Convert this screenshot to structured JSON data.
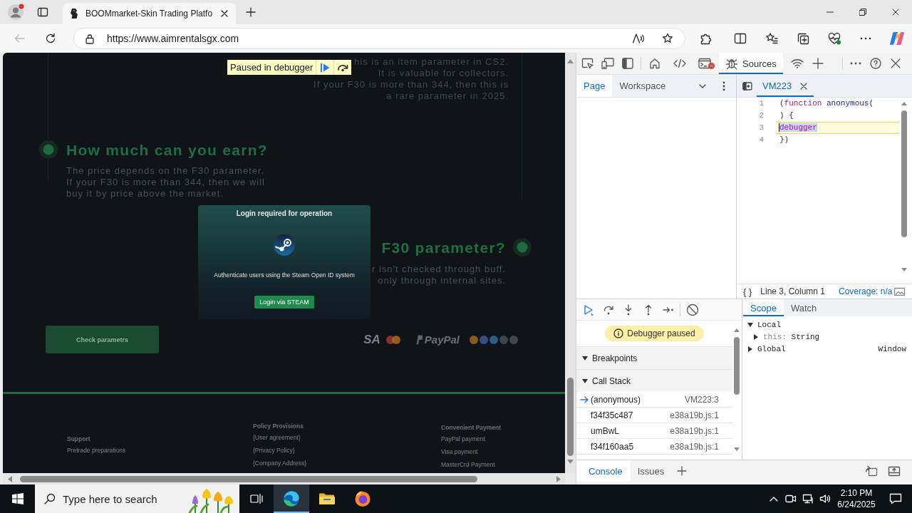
{
  "browser": {
    "tab": {
      "title": "BOOMmarket-Skin Trading Platfo",
      "selected": true
    },
    "back": {
      "disabled": true
    },
    "url": "https://www.aimrentalsgx.com"
  },
  "page": {
    "debugger_banner": "Paused in debugger",
    "intro": [
      {
        "lines": [
          "his is an item parameter in CS2."
        ]
      },
      {
        "lines": [
          "It is valuable for collectors."
        ]
      },
      {
        "lines": [
          "If your F30 is more than 344, then this is",
          "a rare parameter in 2025."
        ]
      }
    ],
    "sections": [
      {
        "heading": "How much can you earn?",
        "lines": [
          "The price depends on the F30 parameter.",
          "If your F30 is more than 344, then we will",
          "buy it by price above the market."
        ]
      },
      {
        "heading": "F30 parameter?",
        "lines": [
          "r isn't checked through buff.",
          "only through internal sites."
        ]
      }
    ],
    "check_button": "Check parametrs",
    "payment_logos": [
      {
        "kind": "visa",
        "text": "SA"
      },
      {
        "kind": "mastercard"
      },
      {
        "kind": "paypal",
        "text": "PayPal"
      },
      {
        "kind": "coins"
      }
    ],
    "modal": {
      "title": "Login required for operation",
      "text": "Authenticate users using the Steam Open ID system",
      "button": "Login via STEAM"
    },
    "footer": [
      {
        "title": "Support",
        "links": [
          "Pretrade preparations"
        ]
      },
      {
        "title": "Policy Provisions",
        "links": [
          "{User agreement}",
          "{Privacy Policy}",
          "{Company Address}"
        ]
      },
      {
        "title": "Convenient Payment",
        "links": [
          "PayPal payment",
          "Visa payment",
          "MasterCrd Payment"
        ]
      }
    ]
  },
  "devtools": {
    "panel_tabs": [
      {
        "kind": "home",
        "selected": false,
        "badge": false
      },
      {
        "kind": "elements",
        "selected": false,
        "badge": false
      },
      {
        "kind": "console",
        "selected": false,
        "badge": true
      },
      {
        "kind": "sources",
        "label": "Sources",
        "selected": true,
        "badge": false
      },
      {
        "kind": "network",
        "selected": false,
        "badge": false
      }
    ],
    "navigator_tabs": [
      {
        "label": "Page",
        "selected": true
      },
      {
        "label": "Workspace",
        "selected": false
      }
    ],
    "editor_tabs": [
      {
        "label": "VM223",
        "selected": true
      }
    ],
    "code": [
      {
        "number": "1",
        "tokens": [
          {
            "kind": "punct",
            "text": "("
          },
          {
            "kind": "keyword",
            "text": "function"
          },
          {
            "kind": "plain",
            "text": " anonymous("
          }
        ],
        "paused": false,
        "selected": false
      },
      {
        "number": "2",
        "tokens": [
          {
            "kind": "punct",
            "text": ") {"
          }
        ],
        "paused": false,
        "selected": false
      },
      {
        "number": "3",
        "tokens": [
          {
            "kind": "keyword",
            "text": "debugger"
          }
        ],
        "paused": true,
        "selected": true
      },
      {
        "number": "4",
        "tokens": [
          {
            "kind": "punct",
            "text": "})"
          }
        ],
        "paused": false,
        "selected": false
      }
    ],
    "status": {
      "format": "{ }",
      "position": "Line 3, Column 1",
      "coverage": "Coverage: n/a"
    },
    "paused_notice": "Debugger paused",
    "panes": [
      {
        "title": "Breakpoints",
        "expanded": true
      },
      {
        "title": "Call Stack",
        "expanded": true,
        "frames": [
          {
            "name": "(anonymous)",
            "location": "VM223:3",
            "current": true
          },
          {
            "name": "f34f35c487",
            "location": "e38a19b.js:1",
            "current": false
          },
          {
            "name": "umBwL",
            "location": "e38a19b.js:1",
            "current": false
          },
          {
            "name": "f34f160aa5",
            "location": "e38a19b.js:1",
            "current": false
          }
        ]
      }
    ],
    "sidebar_tabs": [
      {
        "label": "Scope",
        "selected": true
      },
      {
        "label": "Watch",
        "selected": false
      }
    ],
    "scope": [
      {
        "name": "Local",
        "expanded": true,
        "children": [
          {
            "name": "this:",
            "value": "String",
            "expanded": false
          }
        ]
      },
      {
        "name": "Global",
        "value": "Window",
        "expanded": false
      }
    ],
    "drawer_tabs": [
      {
        "label": "Console",
        "selected": true
      },
      {
        "label": "Issues",
        "selected": false
      }
    ]
  },
  "taskbar": {
    "search": {
      "placeholder": "Type here to search"
    },
    "apps": [
      {
        "kind": "task-view",
        "active": false
      },
      {
        "kind": "edge",
        "active": true
      },
      {
        "kind": "explorer",
        "active": false
      },
      {
        "kind": "firefox",
        "active": false
      }
    ],
    "time": "2:10 PM",
    "date": "6/24/2025"
  }
}
